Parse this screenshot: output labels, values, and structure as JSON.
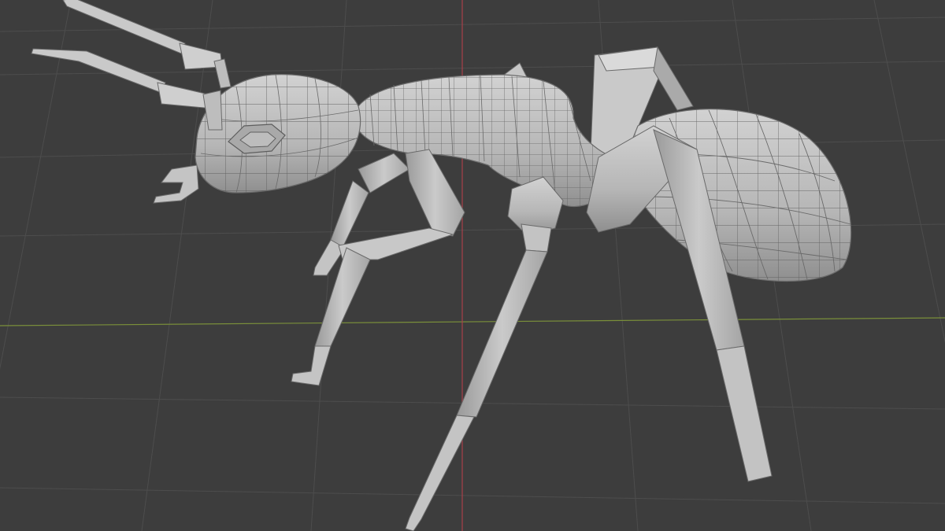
{
  "viewport": {
    "mode": "3d-viewport",
    "object": "ant",
    "shading": "solid",
    "wireframe_overlay": true,
    "grid": true
  },
  "colors": {
    "background": "#3d3d3d",
    "grid_line": "#4c4c4c",
    "x_axis": "#7a8f3a",
    "y_axis": "#a8404a",
    "mesh_fill": "#b9b9b9",
    "mesh_highlight": "#d6d6d6",
    "mesh_shadow": "#8e8e8e",
    "wire": "#5a5a5a"
  }
}
